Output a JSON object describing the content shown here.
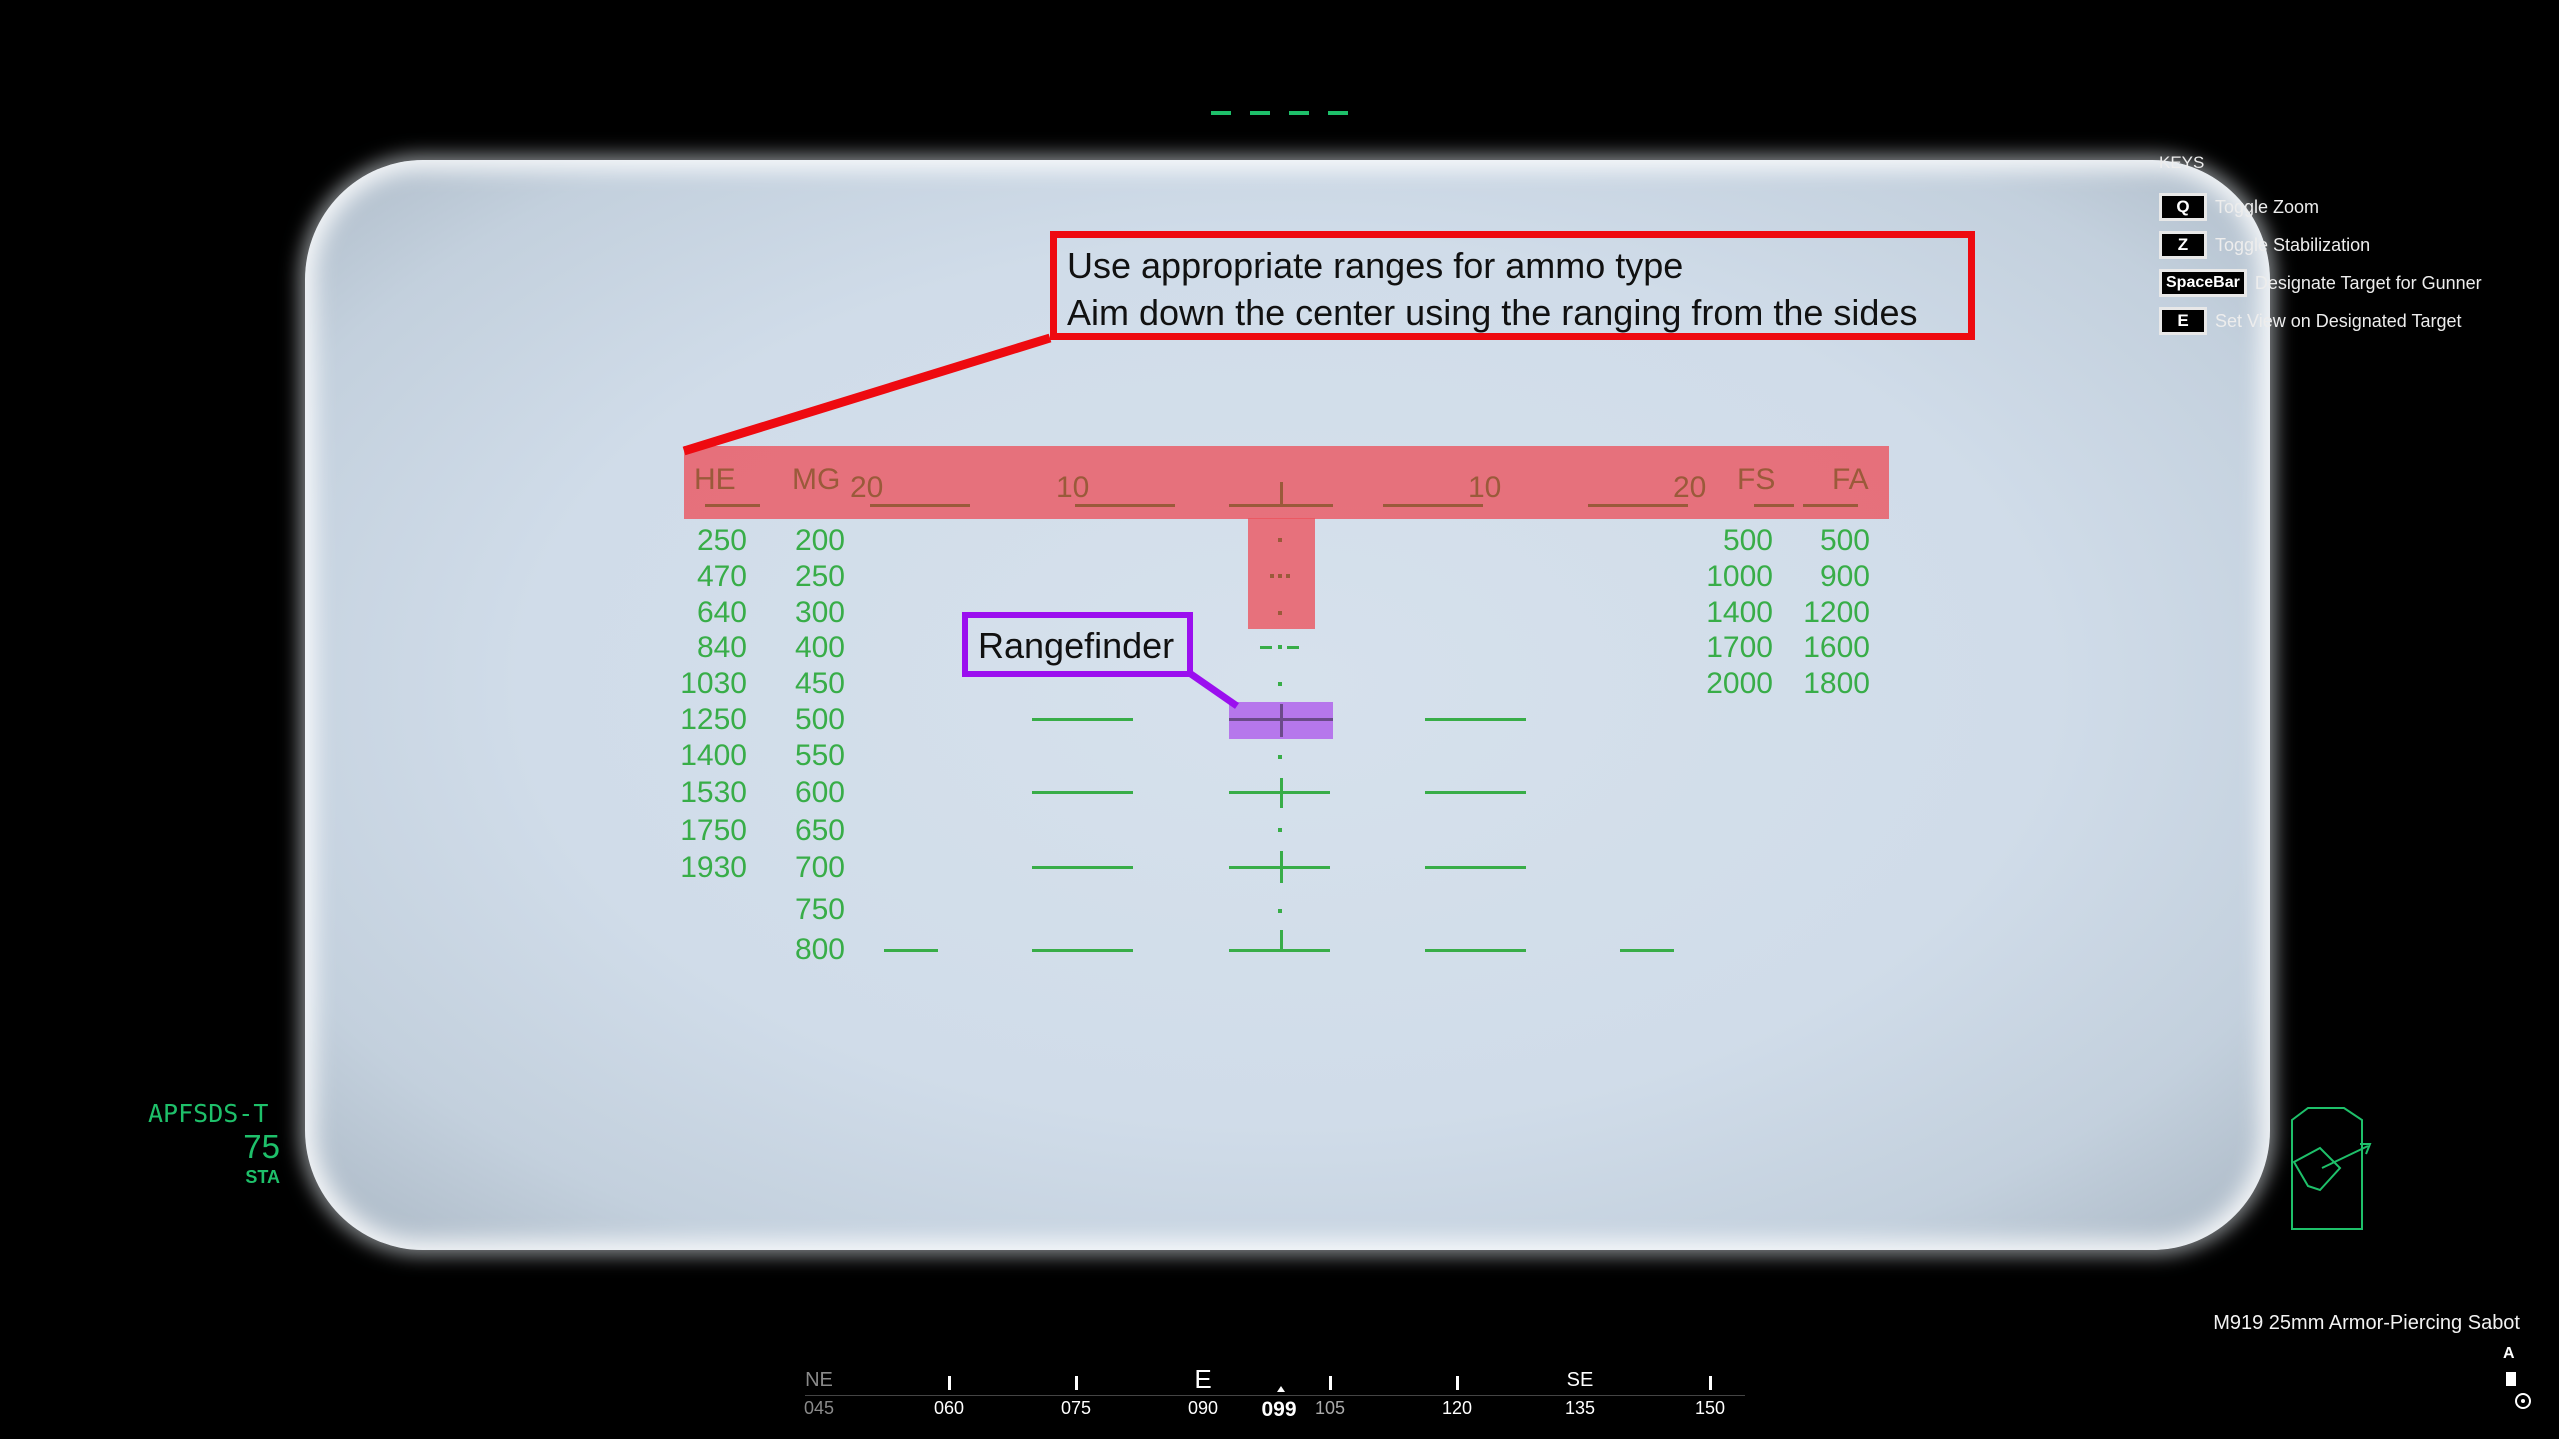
{
  "keys": {
    "title": "KEYS",
    "items": [
      {
        "key": "Q",
        "label": "Toggle Zoom"
      },
      {
        "key": "Z",
        "label": "Toggle Stabilization"
      },
      {
        "key": "SpaceBar",
        "label": "Designate Target for Gunner"
      },
      {
        "key": "E",
        "label": "Set View on Designated Target"
      }
    ]
  },
  "annotations": {
    "instructions": [
      "Use appropriate ranges for ammo type",
      "Aim down the center using the ranging from the sides"
    ],
    "rangefinder": "Rangefinder"
  },
  "reticle": {
    "left_headers": [
      "HE",
      "MG"
    ],
    "right_headers": [
      "FS",
      "FA"
    ],
    "mil_labels": [
      "20",
      "10",
      "10",
      "20"
    ],
    "he": [
      "250",
      "470",
      "640",
      "840",
      "1030",
      "1250",
      "1400",
      "1530",
      "1750",
      "1930"
    ],
    "mg": [
      "200",
      "250",
      "300",
      "400",
      "450",
      "500",
      "550",
      "600",
      "650",
      "700",
      "750",
      "800"
    ],
    "fs": [
      "500",
      "1000",
      "1400",
      "1700",
      "2000"
    ],
    "fa": [
      "500",
      "900",
      "1200",
      "1600",
      "1800"
    ]
  },
  "ammo": {
    "type": "APFSDS-T",
    "count": "75",
    "mode": "STA",
    "name": "M919 25mm Armor-Piercing Sabot"
  },
  "compass": {
    "cardinals": [
      "NE",
      "E",
      "SE"
    ],
    "degrees": [
      "045",
      "060",
      "075",
      "090",
      "099",
      "105",
      "120",
      "135",
      "150"
    ],
    "heading": "099"
  },
  "status": {
    "mode_letter": "A"
  },
  "colors": {
    "reticle": "#38ad48",
    "note_border": "#ee0a10",
    "rangefinder_border": "#9b0fef",
    "hud_green": "#1ec06a"
  }
}
